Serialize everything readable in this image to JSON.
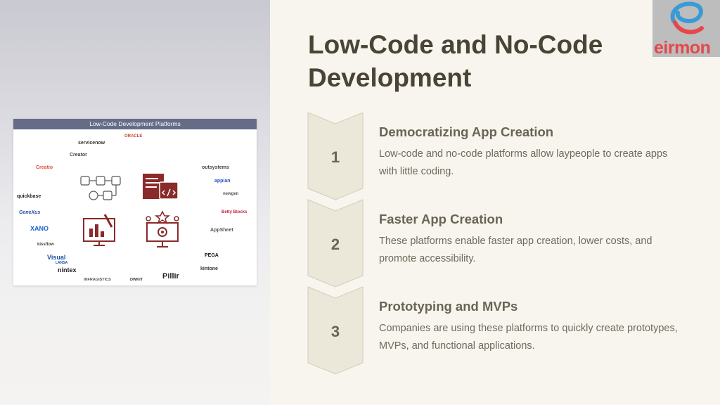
{
  "slide": {
    "title": "Low-Code and No-Code Development"
  },
  "brand": {
    "name": "eirmon",
    "colors": {
      "red": "#e5474b",
      "blue": "#3a9ad6"
    }
  },
  "infographic": {
    "header": "Low-Code Development Platforms",
    "logos": [
      "servicenow",
      "ORACLE",
      "Creator",
      "Creatio",
      "outsystems",
      "appian",
      "newgen",
      "quickbase",
      "GeneXus",
      "Betty Blocks",
      "XANO",
      "AppSheet",
      "kissflow",
      "PEGA",
      "Visual",
      "LANSA",
      "nintex",
      "kintone",
      "INFRAGISTICS",
      "DWKIT",
      "Pillir"
    ],
    "icon_color": "#8a2a2a"
  },
  "steps": [
    {
      "number": "1",
      "title": "Democratizing App Creation",
      "description": "Low-code and no-code platforms allow laypeople to create apps with little coding."
    },
    {
      "number": "2",
      "title": "Faster App Creation",
      "description": "These platforms enable faster app creation, lower costs, and promote accessibility."
    },
    {
      "number": "3",
      "title": "Prototyping and MVPs",
      "description": "Companies are using these platforms to quickly create prototypes, MVPs, and functional applications."
    }
  ],
  "colors": {
    "background": "#f8f5ee",
    "chevron_fill": "#ebe7d9",
    "chevron_stroke": "#d2cdbb",
    "heading": "#4a4436",
    "text": "#6f6a5d"
  }
}
